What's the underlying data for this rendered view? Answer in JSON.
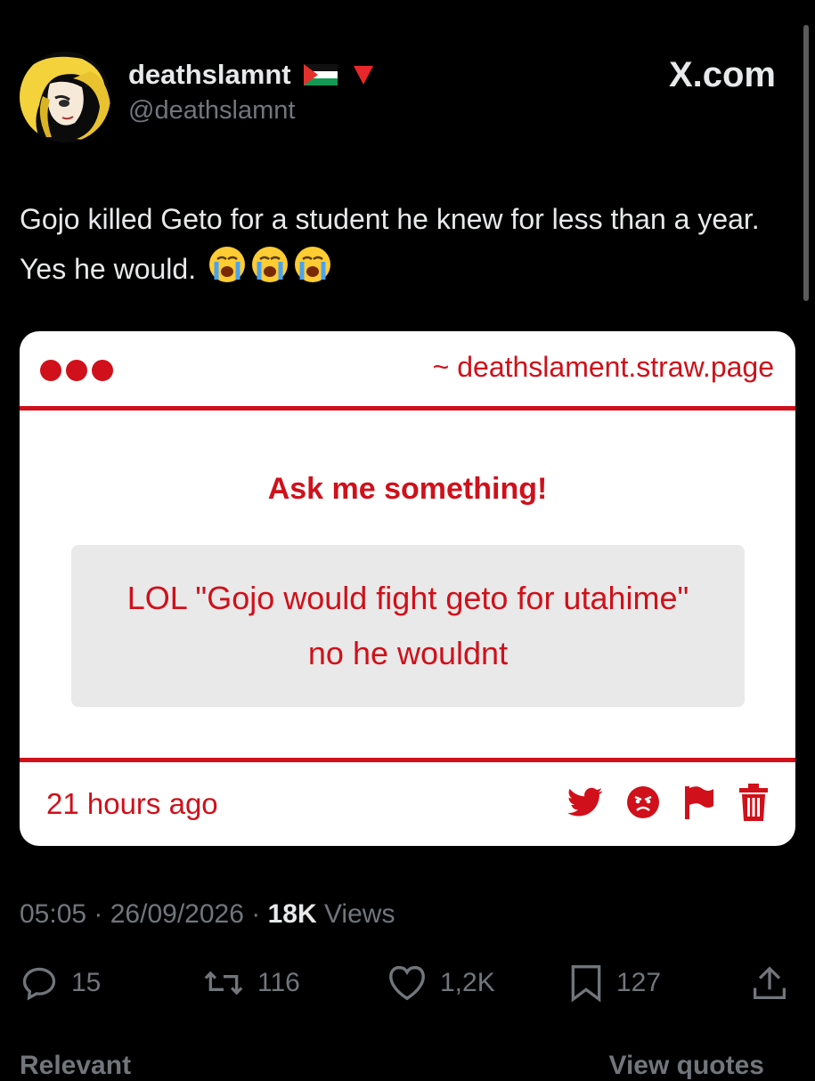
{
  "header": {
    "display_name": "deathslamnt",
    "handle": "@deathslamnt",
    "site_logo": "X.com",
    "flag_icon": "palestine-flag-icon",
    "badge_icon": "red-triangle-down-icon"
  },
  "tweet": {
    "text": "Gojo killed Geto for a student he knew for less than a year. Yes he would.",
    "emoji": [
      "😭",
      "😭",
      "😭"
    ]
  },
  "card": {
    "url": "~ deathslament.straw.page",
    "title": "Ask me something!",
    "question": "LOL \"Gojo would fight geto for utahime\" no he wouldnt",
    "time_ago": "21 hours ago",
    "accent_color": "#d0101a",
    "action_icons": [
      "twitter-bird-icon",
      "angry-face-icon",
      "flag-icon",
      "trash-icon"
    ]
  },
  "meta": {
    "time": "05:05",
    "date": "26/09/2026",
    "views_count": "18K",
    "views_label": "Views"
  },
  "actions": {
    "replies": "15",
    "reposts": "116",
    "likes": "1,2K",
    "bookmarks": "127"
  },
  "footer": {
    "left": "Relevant",
    "right": "View quotes"
  }
}
